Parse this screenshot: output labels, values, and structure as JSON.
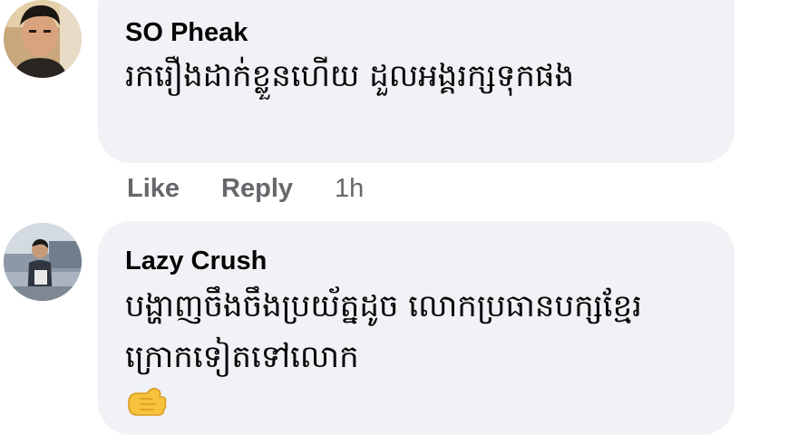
{
  "comments": [
    {
      "author": "SO Pheak",
      "text": "រករឿងដាក់ខ្លួនហើយ ដួលអង្គរក្សទុកផង",
      "actions": {
        "like": "Like",
        "reply": "Reply",
        "time": "1h"
      }
    },
    {
      "author": "Lazy Crush",
      "text": "បង្ហាញចឹងចឹងប្រយ័ត្នដូច លោកប្រធានបក្សខ្មែរក្រោកទៀតទៅលោក",
      "emoji": "flexed-fist-emoji"
    }
  ],
  "colors": {
    "bubble_bg": "#f0f2f5",
    "text": "#050505",
    "secondary_text": "#65676b"
  }
}
